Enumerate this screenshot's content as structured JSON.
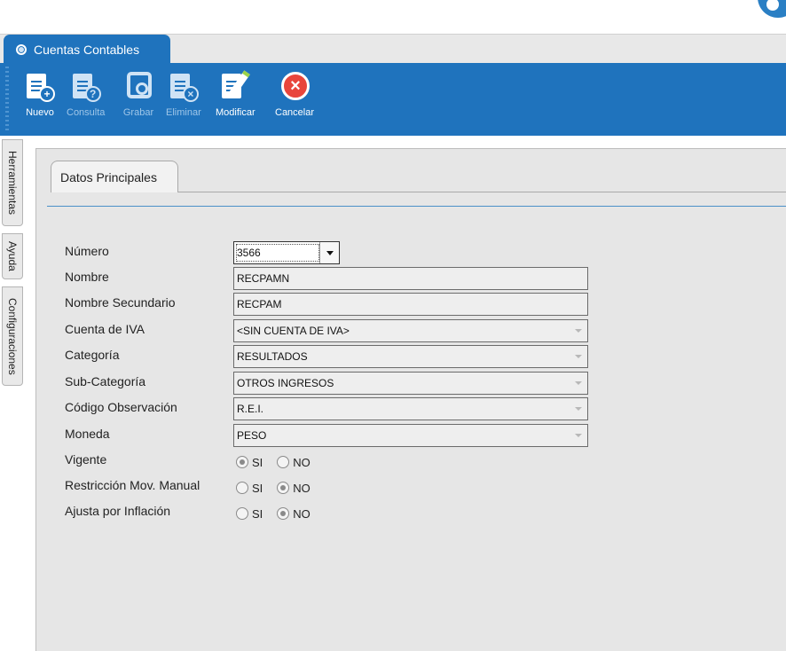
{
  "window": {
    "tab_title": "Cuentas Contables"
  },
  "toolbar": {
    "buttons": [
      {
        "label": "Nuevo",
        "icon": "new-document-icon",
        "enabled": true
      },
      {
        "label": "Consulta",
        "icon": "query-document-icon",
        "enabled": false
      },
      {
        "label": "Grabar",
        "icon": "save-icon",
        "enabled": false
      },
      {
        "label": "Eliminar",
        "icon": "delete-document-icon",
        "enabled": false
      },
      {
        "label": "Modificar",
        "icon": "edit-document-icon",
        "enabled": true
      },
      {
        "label": "Cancelar",
        "icon": "cancel-icon",
        "enabled": true
      }
    ]
  },
  "side_tabs": [
    "Herramientas",
    "Ayuda",
    "Configuraciones"
  ],
  "page_tab": "Datos Principales",
  "form": {
    "numero": {
      "label": "Número",
      "value": "3566"
    },
    "nombre": {
      "label": "Nombre",
      "value": "RECPAMN"
    },
    "nombre_secundario": {
      "label": "Nombre Secundario",
      "value": "RECPAM"
    },
    "cuenta_iva": {
      "label": "Cuenta de IVA",
      "value": "<SIN CUENTA DE IVA>"
    },
    "categoria": {
      "label": "Categoría",
      "value": "RESULTADOS"
    },
    "sub_categoria": {
      "label": "Sub-Categoría",
      "value": "OTROS INGRESOS"
    },
    "codigo_observacion": {
      "label": "Código Observación",
      "value": "R.E.I."
    },
    "moneda": {
      "label": "Moneda",
      "value": "PESO"
    },
    "vigente": {
      "label": "Vigente",
      "selected": "SI"
    },
    "restriccion": {
      "label": "Restricción Mov. Manual",
      "selected": "NO"
    },
    "ajusta_inflacion": {
      "label": "Ajusta por Inflación",
      "selected": "NO"
    },
    "radio_options": {
      "yes": "SI",
      "no": "NO"
    }
  },
  "colors": {
    "accent": "#1f73bd",
    "cancel": "#e8453c"
  }
}
